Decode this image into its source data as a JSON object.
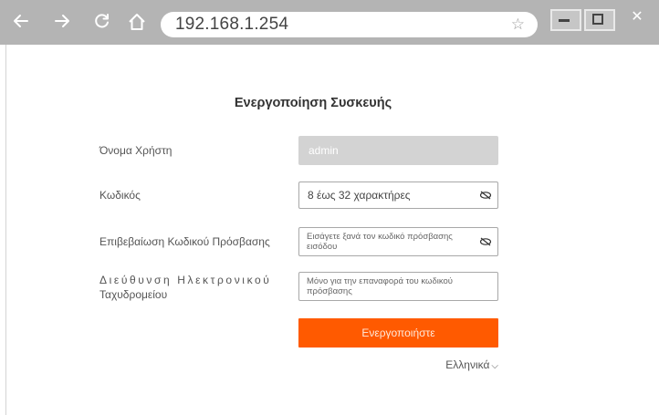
{
  "browser": {
    "url": "192.168.1.254",
    "icons": {
      "back": "back-arrow-icon",
      "forward": "forward-arrow-icon",
      "reload": "reload-icon",
      "home": "home-icon",
      "bookmark": "star-icon",
      "close": "close-icon"
    }
  },
  "page": {
    "title": "Ενεργοποίηση Συσκευής",
    "fields": {
      "username": {
        "label": "Όνομα Χρήστη",
        "value": "admin"
      },
      "password": {
        "label": "Κωδικός",
        "placeholder": "8 έως 32 χαρακτήρες"
      },
      "confirm_password": {
        "label": "Επιβεβαίωση Κωδικού Πρόσβασης",
        "placeholder": "Εισάγετε ξανά τον κωδικό πρόσβασης εισόδου"
      },
      "email": {
        "label_line1": "Διεύθυνση Ηλεκτρονικού",
        "label_line2": "Ταχυδρομείου",
        "placeholder": "Μόνο για την επαναφορά του κωδικού πρόσβασης"
      }
    },
    "submit_label": "Ενεργοποιήστε",
    "language": {
      "selected": "Ελληνικά",
      "chevron": "⌵"
    }
  },
  "colors": {
    "accent": "#ff5a00",
    "chrome": "#b4b4b4",
    "readonly_field": "#d3d3d3"
  }
}
